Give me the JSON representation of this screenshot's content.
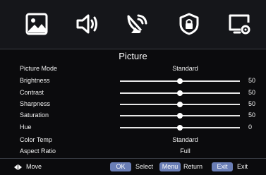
{
  "top_icons": [
    {
      "name": "picture-icon"
    },
    {
      "name": "sound-icon"
    },
    {
      "name": "channel-icon"
    },
    {
      "name": "lock-icon"
    },
    {
      "name": "setup-icon"
    }
  ],
  "menu": {
    "title": "Picture",
    "items": [
      {
        "label": "Picture Mode",
        "value": "Standard"
      },
      {
        "label": "Brightness",
        "value": "50",
        "level": 0.5
      },
      {
        "label": "Contrast",
        "value": "50",
        "level": 0.5
      },
      {
        "label": "Sharpness",
        "value": "50",
        "level": 0.5
      },
      {
        "label": "Saturation",
        "value": "50",
        "level": 0.5
      },
      {
        "label": "Hue",
        "value": "0",
        "level": 0.5
      },
      {
        "label": "Color Temp",
        "value": "Standard"
      },
      {
        "label": "Aspect Ratio",
        "value": "Full"
      }
    ]
  },
  "footer": {
    "move_label": "Move",
    "ok_key": "OK",
    "select_label": "Select",
    "menu_key": "Menu",
    "return_label": "Return",
    "exit_key": "Exit",
    "exit_label": "Exit"
  },
  "colors": {
    "background": "#0b0b0d",
    "icon_bar": "#15161a",
    "key_button": "#6a7eb6",
    "text": "#ffffff"
  }
}
